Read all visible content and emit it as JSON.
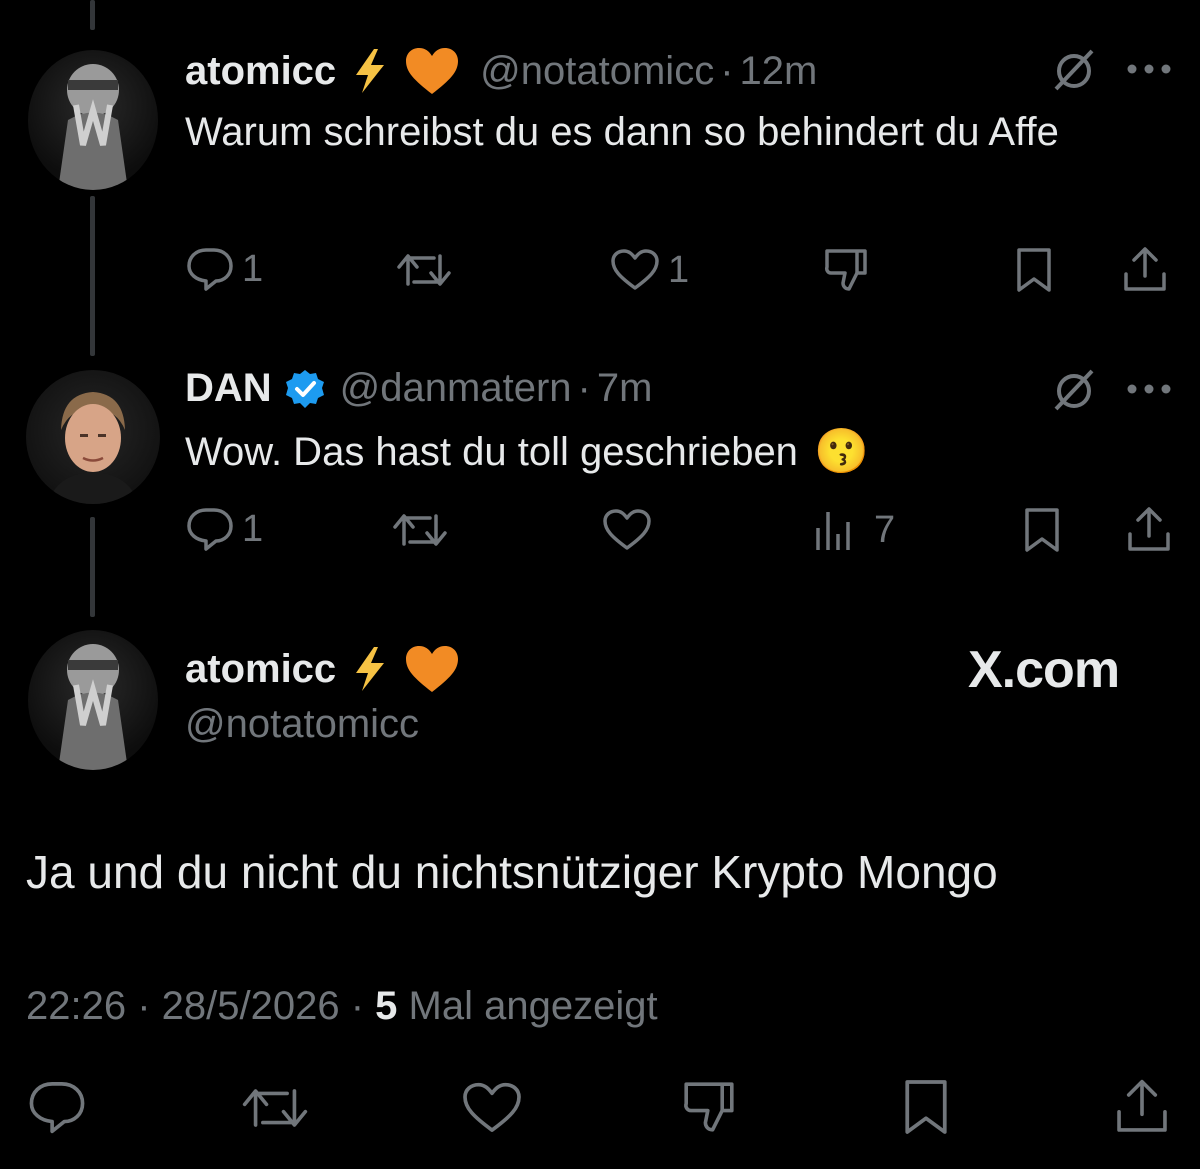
{
  "tweets": [
    {
      "name": "atomicc",
      "handle": "@notatomicc",
      "time": "12m",
      "text": "Warum schreibst du es dann so behindert du Affe",
      "replies": "1",
      "likes": "1"
    },
    {
      "name": "DAN",
      "handle": "@danmatern",
      "time": "7m",
      "text": "Wow. Das hast du toll geschrieben",
      "emoji": "😗",
      "replies": "1",
      "views": "7"
    }
  ],
  "main_tweet": {
    "name": "atomicc",
    "handle": "@notatomicc",
    "text": "Ja und du nicht du nichtsnütziger Krypto Mongo",
    "timestamp": "22:26 · 28/5/2026 ·",
    "views_count": "5",
    "views_label": "Mal angezeigt"
  },
  "watermark": "X.com",
  "separator": "·",
  "colors": {
    "background": "#000000",
    "text": "#e7e9ea",
    "muted": "#71767b",
    "verified": "#1d9bf0",
    "heart_emoji": "#f28b24",
    "lightning": "#f6c244"
  }
}
